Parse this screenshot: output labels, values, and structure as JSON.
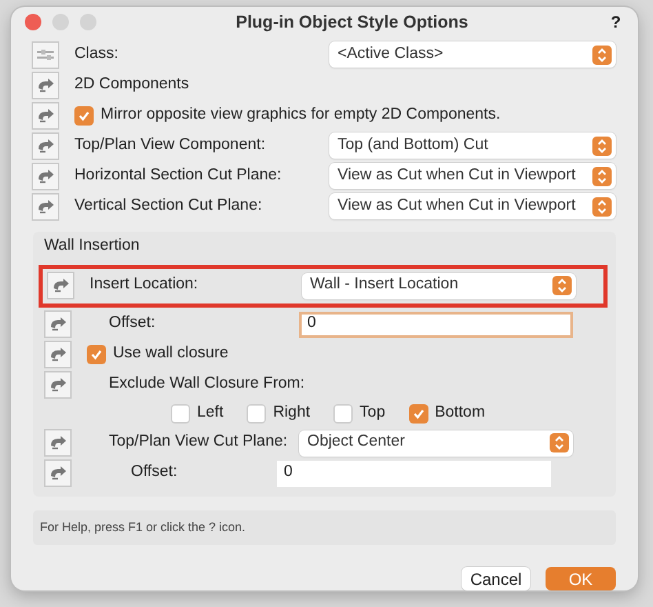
{
  "window": {
    "title": "Plug-in Object Style Options",
    "help": "?"
  },
  "rows": [
    {
      "kind": "select",
      "label": "Class:",
      "value": "<Active Class>"
    },
    {
      "kind": "label",
      "label": "2D Components"
    },
    {
      "kind": "check",
      "label": "Mirror opposite view graphics for empty 2D Components.",
      "checked": true
    },
    {
      "kind": "select",
      "label": "Top/Plan View Component:",
      "value": "Top (and Bottom) Cut"
    },
    {
      "kind": "select",
      "label": "Horizontal Section Cut Plane:",
      "value": "View as Cut when Cut in Viewport"
    },
    {
      "kind": "select",
      "label": "Vertical Section Cut Plane:",
      "value": "View as Cut when Cut in Viewport"
    }
  ],
  "group": {
    "title": "Wall Insertion",
    "rows": [
      {
        "kind": "select",
        "label": "Insert Location:",
        "value": "Wall - Insert Location",
        "highlighted": true
      },
      {
        "kind": "field",
        "label": "Offset:",
        "value": "0",
        "focused": true
      },
      {
        "kind": "check",
        "label": "Use wall closure",
        "checked": true
      },
      {
        "kind": "label",
        "label": "Exclude Wall Closure From:"
      },
      {
        "kind": "checks",
        "items": [
          {
            "label": "Left",
            "checked": false
          },
          {
            "label": "Right",
            "checked": false
          },
          {
            "label": "Top",
            "checked": false
          },
          {
            "label": "Bottom",
            "checked": true
          }
        ]
      },
      {
        "kind": "select",
        "label": "Top/Plan View Cut Plane:",
        "value": "Object Center"
      },
      {
        "kind": "field",
        "label": "Offset:",
        "value": "0",
        "focused": false
      }
    ]
  },
  "help_text": "For Help, press F1 or click the ? icon.",
  "buttons": [
    {
      "label": "Cancel",
      "kind": "secondary"
    },
    {
      "label": "OK",
      "kind": "primary"
    }
  ]
}
